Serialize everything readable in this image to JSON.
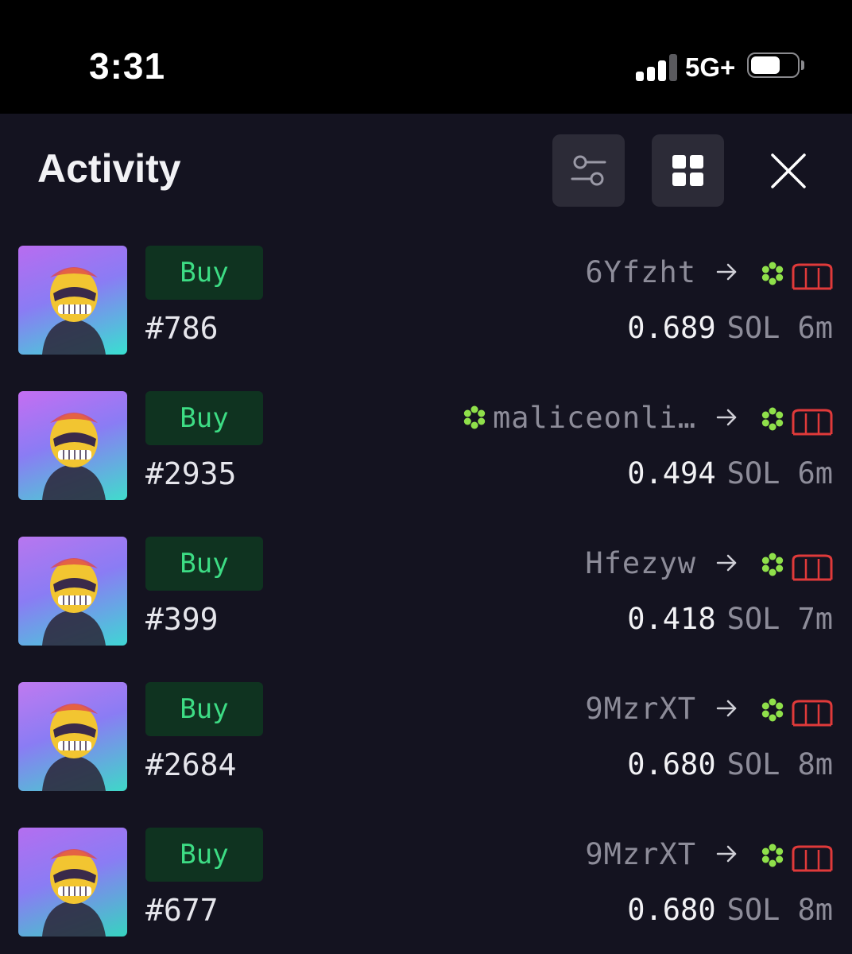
{
  "status_bar": {
    "time": "3:31",
    "network": "5G+",
    "signal_bars": 4,
    "signal_active": 3,
    "battery_level": 0.65
  },
  "header": {
    "title": "Activity",
    "filter_icon": "sliders-icon",
    "grid_icon": "grid-icon",
    "close_icon": "close-icon"
  },
  "colors": {
    "background": "#141320",
    "buy_text": "#3ddc84",
    "buy_bg": "#0f3320",
    "muted": "#8d8c99",
    "magiceden_red": "#e03a3a",
    "badge_green": "#8fe04a"
  },
  "activities": [
    {
      "type": "Buy",
      "token": "#786",
      "buyer": "6Yfzht",
      "buyer_badge": false,
      "price": "0.689",
      "currency": "SOL",
      "age": "6m",
      "thumb_bg": [
        "#b86cf0",
        "#38e0d0"
      ]
    },
    {
      "type": "Buy",
      "token": "#2935",
      "buyer": "maliceonli…",
      "buyer_badge": true,
      "price": "0.494",
      "currency": "SOL",
      "age": "6m",
      "thumb_bg": [
        "#c56ef2",
        "#40dccc"
      ]
    },
    {
      "type": "Buy",
      "token": "#399",
      "buyer": "Hfezyw",
      "buyer_badge": false,
      "price": "0.418",
      "currency": "SOL",
      "age": "7m",
      "thumb_bg": [
        "#b876ef",
        "#3fd6d4"
      ]
    },
    {
      "type": "Buy",
      "token": "#2684",
      "buyer": "9MzrXT",
      "buyer_badge": false,
      "price": "0.680",
      "currency": "SOL",
      "age": "8m",
      "thumb_bg": [
        "#c07af0",
        "#3ed8c8"
      ]
    },
    {
      "type": "Buy",
      "token": "#677",
      "buyer": "9MzrXT",
      "buyer_badge": false,
      "price": "0.680",
      "currency": "SOL",
      "age": "8m",
      "thumb_bg": [
        "#b46ef0",
        "#36d4c0"
      ]
    }
  ]
}
